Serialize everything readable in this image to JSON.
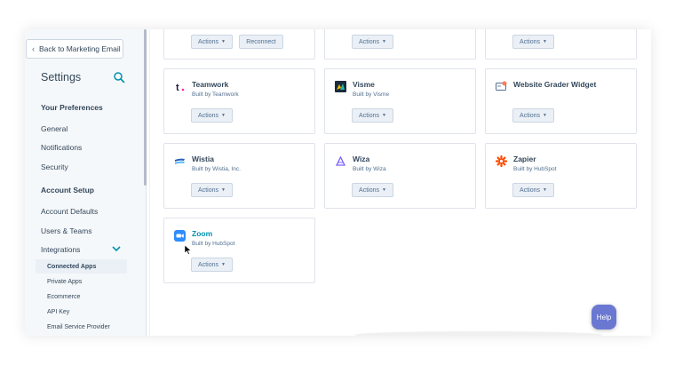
{
  "sidebar": {
    "back_label": "Back to Marketing Email",
    "title": "Settings",
    "sections": {
      "preferences_heading": "Your Preferences",
      "general": "General",
      "notifications": "Notifications",
      "security": "Security",
      "account_heading": "Account Setup",
      "account_defaults": "Account Defaults",
      "users_teams": "Users & Teams",
      "integrations": "Integrations",
      "connected_apps": "Connected Apps",
      "private_apps": "Private Apps",
      "ecommerce": "Ecommerce",
      "api_key": "API Key",
      "email_service_provider": "Email Service Provider"
    }
  },
  "apps": {
    "top_row": {
      "actions": "Actions",
      "reconnect": "Reconnect"
    },
    "teamwork": {
      "name": "Teamwork",
      "by": "Built by Teamwork",
      "actions": "Actions"
    },
    "visme": {
      "name": "Visme",
      "by": "Built by Visme",
      "actions": "Actions"
    },
    "website_grader": {
      "name": "Website Grader Widget",
      "actions": "Actions"
    },
    "wistia": {
      "name": "Wistia",
      "by": "Built by Wistia, Inc.",
      "actions": "Actions"
    },
    "wiza": {
      "name": "Wiza",
      "by": "Built by Wiza",
      "actions": "Actions"
    },
    "zapier": {
      "name": "Zapier",
      "by": "Built by HubSpot",
      "actions": "Actions"
    },
    "zoom": {
      "name": "Zoom",
      "by": "Built by HubSpot",
      "actions": "Actions"
    }
  },
  "help_label": "Help",
  "colors": {
    "accent": "#0091ae",
    "help": "#6a78d1",
    "zapier": "#ff4a00",
    "zoom": "#2d8cff",
    "wistia": "#2b5fb8"
  }
}
